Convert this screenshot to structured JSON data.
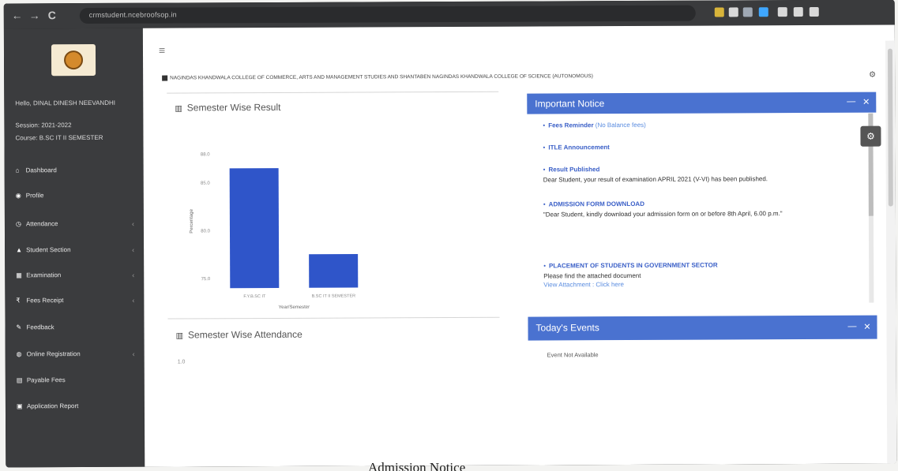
{
  "browser": {
    "url": "crmstudent.ncebroofsop.in",
    "back_glyph": "←",
    "forward_glyph": "→",
    "reload_glyph": "C",
    "ext_colors": [
      "#d8b43a",
      "#d9d9d9",
      "#9fa8b4",
      "#3fa7ff",
      "#d9d9d9",
      "#d9d9d9",
      "#d9d9d9"
    ]
  },
  "sidebar": {
    "user_name": "Hello, DINAL DINESH NEEVANDHI",
    "session": "Session: 2021-2022",
    "course": "Course: B.SC IT II SEMESTER",
    "items": [
      {
        "label": "Dashboard",
        "icon": "home-icon",
        "glyph": "⌂",
        "caret": false
      },
      {
        "label": "Profile",
        "icon": "profile-icon",
        "glyph": "◉",
        "caret": false
      },
      {
        "label": "Attendance",
        "icon": "clock-icon",
        "glyph": "◷",
        "caret": true
      },
      {
        "label": "Student Section",
        "icon": "user-icon",
        "glyph": "▲",
        "caret": true
      },
      {
        "label": "Examination",
        "icon": "exam-icon",
        "glyph": "▦",
        "caret": true
      },
      {
        "label": "Fees Receipt",
        "icon": "rupee-icon",
        "glyph": "₹",
        "caret": true
      },
      {
        "label": "Feedback",
        "icon": "feedback-icon",
        "glyph": "✎",
        "caret": false
      },
      {
        "label": "Online Registration",
        "icon": "registration-icon",
        "glyph": "◍",
        "caret": true
      },
      {
        "label": "Payable Fees",
        "icon": "fees-icon",
        "glyph": "▤",
        "caret": false
      },
      {
        "label": "Application Report",
        "icon": "report-icon",
        "glyph": "▣",
        "caret": false
      }
    ]
  },
  "header": {
    "hamburger_icon": "≡",
    "college_name": "NAGINDAS KHANDWALA COLLEGE OF COMMERCE, ARTS AND MANAGEMENT STUDIES AND SHANTABEN NAGINDAS KHANDWALA COLLEGE OF SCIENCE (AUTONOMOUS)",
    "settings_glyph": "⚙"
  },
  "result_panel": {
    "title": "Semester Wise Result",
    "icon_glyph": "▥"
  },
  "chart_data": {
    "type": "bar",
    "categories": [
      "F.Y.B.SC IT",
      "B.SC IT II SEMESTER"
    ],
    "values": [
      86.5,
      77.5
    ],
    "xlabel": "Year/Semester",
    "ylabel": "Percentage",
    "yticks": [
      75.0,
      80.0,
      85.0,
      88.0
    ],
    "ytick_labels": [
      "75.0",
      "80.0",
      "85.0",
      "88.0"
    ],
    "ylim": [
      74,
      88
    ],
    "color": "#2f55c9"
  },
  "attendance_panel": {
    "title": "Semester Wise Attendance",
    "icon_glyph": "▥",
    "tick": "1.0"
  },
  "notice_panel": {
    "title": "Important Notice",
    "minimize_glyph": "—",
    "close_glyph": "✕",
    "notices": [
      {
        "title": "Fees Reminder",
        "link": "(No Balance fees)",
        "body": ""
      },
      {
        "title": "ITLE Announcement",
        "link": "",
        "body": ""
      },
      {
        "title": "Result Published",
        "link": "",
        "body": "Dear Student, your result of examination APRIL 2021 (V-VI) has been published."
      },
      {
        "title": "ADMISSION FORM DOWNLOAD",
        "link": "",
        "body": "\"Dear Student, kindly download your admission form on or before 8th April, 6.00 p.m.\""
      },
      {
        "title": "PLACEMENT OF STUDENTS IN GOVERNMENT SECTOR",
        "link": "",
        "body": "Please find the attached document",
        "attachment": "View Attachment : Click here"
      }
    ]
  },
  "events_panel": {
    "title": "Today's Events",
    "minimize_glyph": "—",
    "close_glyph": "✕",
    "text": "Event Not Available"
  },
  "gear_float_glyph": "⚙",
  "caption": "Admission Notice"
}
